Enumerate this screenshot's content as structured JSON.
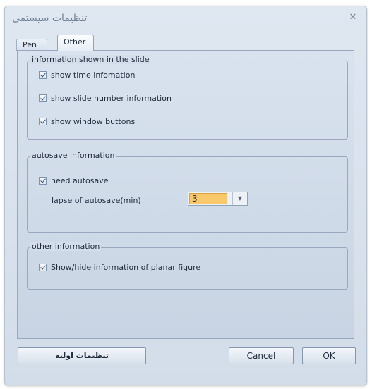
{
  "window": {
    "title": "تنظیمات سیستمی",
    "close_icon": "close-icon"
  },
  "tabs": [
    {
      "label": "Pen",
      "selected": false
    },
    {
      "label": "Other",
      "selected": true
    }
  ],
  "groups": {
    "slide_info": {
      "title": "information shown in the slide",
      "items": [
        {
          "label": "show time infomation",
          "checked": true
        },
        {
          "label": "show slide number information",
          "checked": true
        },
        {
          "label": "show window buttons",
          "checked": true
        }
      ]
    },
    "autosave": {
      "title": "autosave information",
      "need_autosave": {
        "label": "need autosave",
        "checked": true
      },
      "lapse_label": "lapse of autosave(min)",
      "lapse_value": "3"
    },
    "other": {
      "title": "other information",
      "items": [
        {
          "label": "Show/hide information of planar figure",
          "checked": true
        }
      ]
    }
  },
  "buttons": {
    "defaults": "تنظیمات اولیه",
    "cancel": "Cancel",
    "ok": "OK"
  },
  "colors": {
    "accent_selection": "#f9c86a",
    "dialog_background": "#d3dde9"
  }
}
